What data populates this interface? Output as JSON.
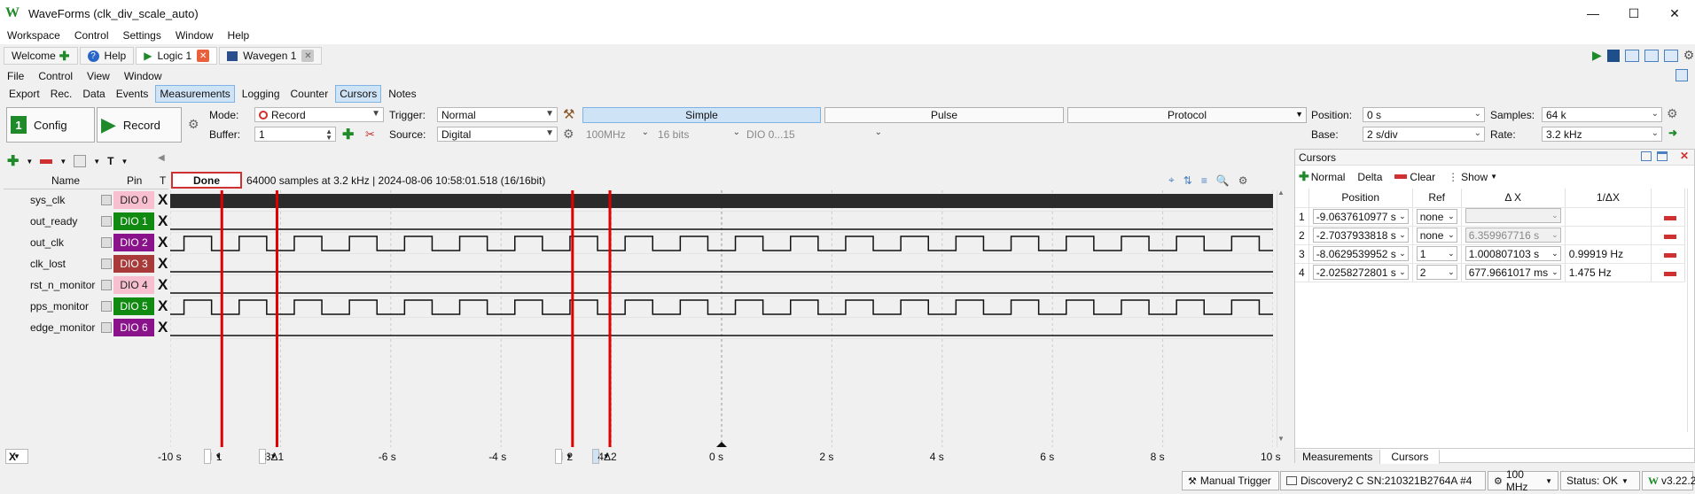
{
  "window": {
    "title": "WaveForms (clk_div_scale_auto)",
    "minimize": "—",
    "maximize": "☐",
    "close": "✕"
  },
  "menubar": [
    "Workspace",
    "Control",
    "Settings",
    "Window",
    "Help"
  ],
  "doc_tabs": [
    {
      "label": "Welcome",
      "icon": "plus-icon"
    },
    {
      "label": "Help",
      "icon": "help-icon"
    },
    {
      "label": "Logic 1",
      "icon": "play-icon",
      "active": true
    },
    {
      "label": "Wavegen 1",
      "icon": "wavegen-icon"
    }
  ],
  "instrument_menu": [
    "File",
    "Control",
    "View",
    "Window"
  ],
  "view_tabs": [
    {
      "label": "Export"
    },
    {
      "label": "Rec."
    },
    {
      "label": "Data"
    },
    {
      "label": "Events"
    },
    {
      "label": "Measurements",
      "selected": true
    },
    {
      "label": "Logging"
    },
    {
      "label": "Counter"
    },
    {
      "label": "Cursors",
      "selected": true
    },
    {
      "label": "Notes"
    }
  ],
  "controls": {
    "config_label": "Config",
    "record_label": "Record",
    "mode_label": "Mode:",
    "mode_value": "Record",
    "buffer_label": "Buffer:",
    "buffer_value": "1",
    "trigger_label": "Trigger:",
    "trigger_value": "Normal",
    "source_label": "Source:",
    "source_value": "Digital",
    "freq_value": "100MHz",
    "bits_value": "16 bits",
    "dio_range": "DIO 0...15",
    "protocol_tabs": [
      "Simple",
      "Pulse",
      "Protocol"
    ],
    "position_label": "Position:",
    "position_value": "0 s",
    "base_label": "Base:",
    "base_value": "2 s/div",
    "samples_label": "Samples:",
    "samples_value": "64 k",
    "rate_label": "Rate:",
    "rate_value": "3.2 kHz"
  },
  "acquisition": {
    "status": "Done",
    "info": "64000 samples at 3.2 kHz | 2024-08-06 10:58:01.518 (16/16bit)"
  },
  "channel_headers": {
    "name": "Name",
    "pin": "Pin",
    "trigger": "T"
  },
  "channels": [
    {
      "name": "sys_clk",
      "pin": "DIO 0",
      "color": "#f7bfd0",
      "text_color": "#222",
      "trigger": "X"
    },
    {
      "name": "out_ready",
      "pin": "DIO 1",
      "color": "#108a10",
      "text_color": "#fff",
      "trigger": "X"
    },
    {
      "name": "out_clk",
      "pin": "DIO 2",
      "color": "#8a128a",
      "text_color": "#fff",
      "trigger": "X"
    },
    {
      "name": "clk_lost",
      "pin": "DIO 3",
      "color": "#a83a3a",
      "text_color": "#fff",
      "trigger": "X"
    },
    {
      "name": "rst_n_monitor",
      "pin": "DIO 4",
      "color": "#f7bfd0",
      "text_color": "#222",
      "trigger": "X"
    },
    {
      "name": "pps_monitor",
      "pin": "DIO 5",
      "color": "#108a10",
      "text_color": "#fff",
      "trigger": "X"
    },
    {
      "name": "edge_monitor",
      "pin": "DIO 6",
      "color": "#8a128a",
      "text_color": "#fff",
      "trigger": "X"
    }
  ],
  "time_axis": {
    "ticks": [
      "-10 s",
      "-6 s",
      "-4 s",
      "0 s",
      "2 s",
      "4 s",
      "6 s",
      "8 s",
      "10 s"
    ],
    "x_selector": "X",
    "cursor_boxes": [
      "1",
      "3Δ1",
      "2",
      "4Δ2"
    ]
  },
  "cursor_panel": {
    "title": "Cursors",
    "toolbar": {
      "normal": "Normal",
      "delta": "Delta",
      "clear": "Clear",
      "show": "Show"
    },
    "columns": [
      "Position",
      "Ref",
      "Δ X",
      "1/ΔX"
    ],
    "rows": [
      {
        "index": "1",
        "position": "-9.0637610977 s",
        "ref": "none",
        "dx": "",
        "inv": ""
      },
      {
        "index": "2",
        "position": "-2.7037933818 s",
        "ref": "none",
        "dx": "6.359967716 s",
        "inv": ""
      },
      {
        "index": "3",
        "position": "-8.0629539952 s",
        "ref": "1",
        "dx": "1.000807103 s",
        "inv": "0.99919 Hz"
      },
      {
        "index": "4",
        "position": "-2.0258272801 s",
        "ref": "2",
        "dx": "677.9661017 ms",
        "inv": "1.475 Hz"
      }
    ],
    "bottom_tabs": [
      "Measurements",
      "Cursors"
    ]
  },
  "statusbar": {
    "manual_trigger": "Manual Trigger",
    "device": "Discovery2 C SN:210321B2764A #4",
    "clock": "100 MHz",
    "status": "Status: OK",
    "version": "v3.22.2"
  },
  "colors": {
    "cursor_line": "#e00000",
    "accent_green": "#1f8a2a",
    "selection_blue": "#cfe3f7"
  }
}
